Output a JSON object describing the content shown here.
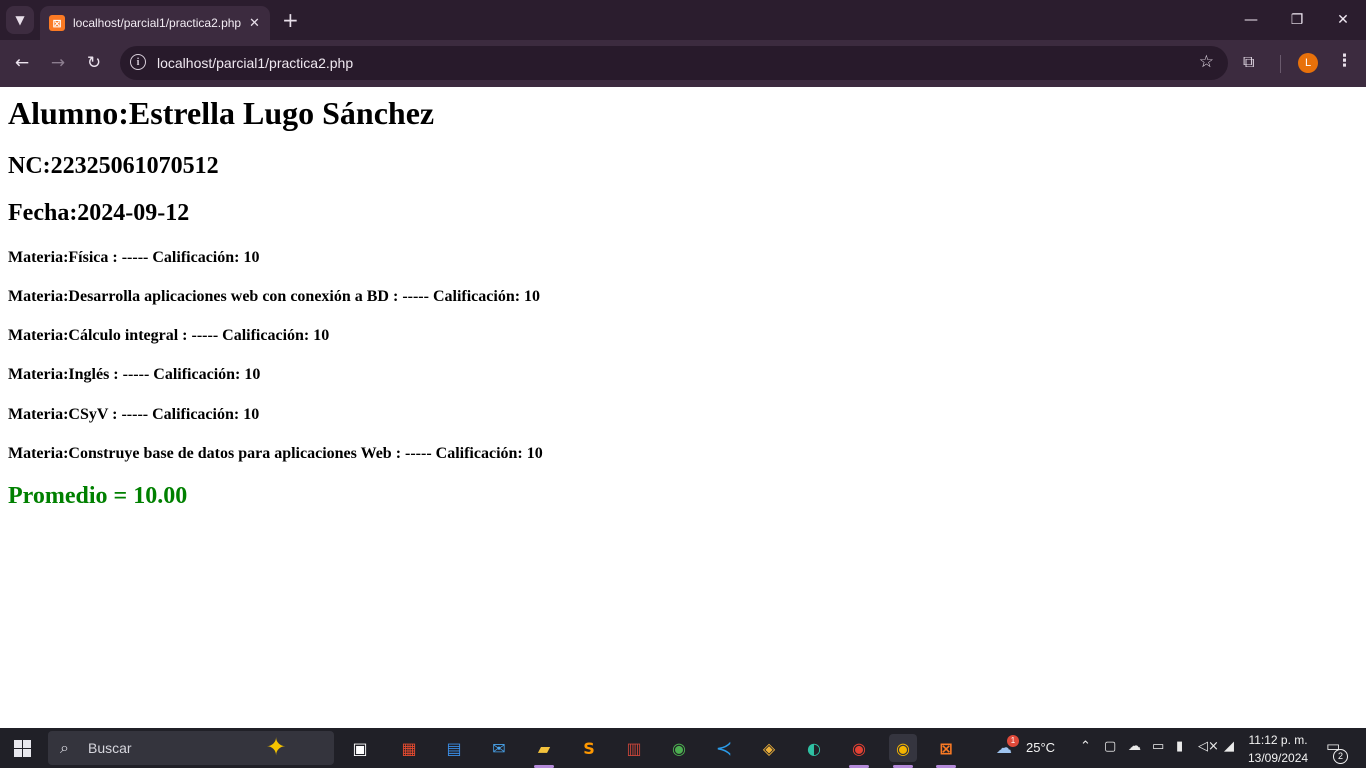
{
  "browser": {
    "tab_title": "localhost/parcial1/practica2.php",
    "url": "localhost/parcial1/practica2.php",
    "profile_initial": "L"
  },
  "page": {
    "alumno": "Alumno:Estrella Lugo Sánchez",
    "nc": "NC:22325061070512",
    "fecha": "Fecha:2024-09-12",
    "materias": [
      "Materia:Física : ----- Calificación: 10",
      "Materia:Desarrolla aplicaciones web con conexión a BD : ----- Calificación: 10",
      "Materia:Cálculo integral : ----- Calificación: 10",
      "Materia:Inglés : ----- Calificación: 10",
      "Materia:CSyV : ----- Calificación: 10",
      "Materia:Construye base de datos para aplicaciones Web : ----- Calificación: 10"
    ],
    "promedio": "Promedio = 10.00",
    "promedio_color": "#008000"
  },
  "taskbar": {
    "search_placeholder": "Buscar",
    "weather_temp": "25°C",
    "weather_badge": "1",
    "time": "11:12 p. m.",
    "date": "13/09/2024",
    "notifications": "2"
  },
  "colors": {
    "tabstrip": "#2b1d2e",
    "toolbar": "#3c2b3f",
    "taskbar": "#202027"
  }
}
